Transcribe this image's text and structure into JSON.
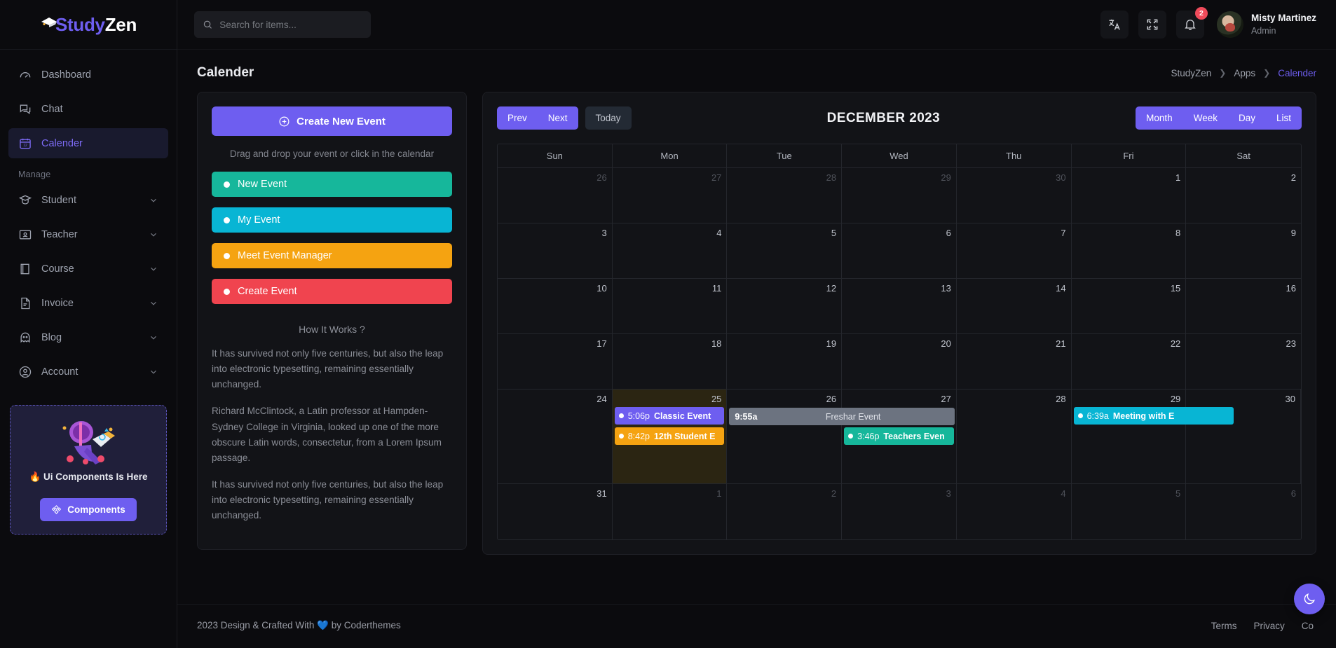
{
  "brand": {
    "part1": "Study",
    "part2": "Zen"
  },
  "sidebar": {
    "items": [
      {
        "label": "Dashboard",
        "icon": "gauge-icon",
        "active": false,
        "chevron": false
      },
      {
        "label": "Chat",
        "icon": "chat-icon",
        "active": false,
        "chevron": false
      },
      {
        "label": "Calender",
        "icon": "calendar-icon",
        "active": true,
        "chevron": false
      }
    ],
    "section_title": "Manage",
    "manage_items": [
      {
        "label": "Student",
        "icon": "graduation-cap-icon",
        "chevron": true
      },
      {
        "label": "Teacher",
        "icon": "teacher-board-icon",
        "chevron": true
      },
      {
        "label": "Course",
        "icon": "book-icon",
        "chevron": true
      },
      {
        "label": "Invoice",
        "icon": "file-text-icon",
        "chevron": true
      },
      {
        "label": "Blog",
        "icon": "ghost-icon",
        "chevron": true
      },
      {
        "label": "Account",
        "icon": "user-circle-icon",
        "chevron": true
      }
    ],
    "promo": {
      "title": "🔥 Ui Components Is Here",
      "button_label": "Components",
      "button_icon": "components-icon"
    }
  },
  "topbar": {
    "search": {
      "placeholder": "Search for items...",
      "value": "",
      "icon": "search-icon"
    },
    "language_icon": "translate-icon",
    "fullscreen_icon": "fullscreen-icon",
    "notification_icon": "bell-icon",
    "notification_count": "2",
    "user": {
      "name": "Misty Martinez",
      "role": "Admin"
    }
  },
  "page": {
    "title": "Calender",
    "breadcrumb": [
      {
        "label": "StudyZen",
        "current": false
      },
      {
        "label": "Apps",
        "current": false
      },
      {
        "label": "Calender",
        "current": true
      }
    ]
  },
  "left_panel": {
    "create_button": {
      "label": "Create New Event",
      "icon": "plus-circle-icon"
    },
    "hint": "Drag and drop your event or click in the calendar",
    "draggable_events": [
      {
        "label": "New Event",
        "color": "#16b79b"
      },
      {
        "label": "My Event",
        "color": "#08b5d4"
      },
      {
        "label": "Meet Event Manager",
        "color": "#f5a311"
      },
      {
        "label": "Create Event",
        "color": "#f0444f"
      }
    ],
    "how_it_works_title": "How It Works ?",
    "paragraphs": [
      "It has survived not only five centuries, but also the leap into electronic typesetting, remaining essentially unchanged.",
      "Richard McClintock, a Latin professor at Hampden-Sydney College in Virginia, looked up one of the more obscure Latin words, consectetur, from a Lorem Ipsum passage.",
      "It has survived not only five centuries, but also the leap into electronic typesetting, remaining essentially unchanged."
    ]
  },
  "calendar": {
    "nav": {
      "prev": "Prev",
      "next": "Next",
      "today": "Today"
    },
    "title": "DECEMBER 2023",
    "views": [
      "Month",
      "Week",
      "Day",
      "List"
    ],
    "active_view": "Month",
    "weekdays": [
      "Sun",
      "Mon",
      "Tue",
      "Wed",
      "Thu",
      "Fri",
      "Sat"
    ],
    "weeks": [
      [
        {
          "day": "26",
          "other": true
        },
        {
          "day": "27",
          "other": true
        },
        {
          "day": "28",
          "other": true
        },
        {
          "day": "29",
          "other": true
        },
        {
          "day": "30",
          "other": true
        },
        {
          "day": "1",
          "other": false
        },
        {
          "day": "2",
          "other": false
        }
      ],
      [
        {
          "day": "3"
        },
        {
          "day": "4"
        },
        {
          "day": "5"
        },
        {
          "day": "6"
        },
        {
          "day": "7"
        },
        {
          "day": "8"
        },
        {
          "day": "9"
        }
      ],
      [
        {
          "day": "10"
        },
        {
          "day": "11"
        },
        {
          "day": "12"
        },
        {
          "day": "13"
        },
        {
          "day": "14"
        },
        {
          "day": "15"
        },
        {
          "day": "16"
        }
      ],
      [
        {
          "day": "17"
        },
        {
          "day": "18"
        },
        {
          "day": "19"
        },
        {
          "day": "20"
        },
        {
          "day": "21"
        },
        {
          "day": "22"
        },
        {
          "day": "23"
        }
      ],
      [
        {
          "day": "24"
        },
        {
          "day": "25",
          "highlight": true
        },
        {
          "day": "26"
        },
        {
          "day": "27"
        },
        {
          "day": "28"
        },
        {
          "day": "29"
        },
        {
          "day": "30"
        }
      ],
      [
        {
          "day": "31"
        },
        {
          "day": "1",
          "other": true
        },
        {
          "day": "2",
          "other": true
        },
        {
          "day": "3",
          "other": true
        },
        {
          "day": "4",
          "other": true
        },
        {
          "day": "5",
          "other": true
        },
        {
          "day": "6",
          "other": true
        }
      ]
    ],
    "events": [
      {
        "time": "5:06p",
        "name": "Classic Event",
        "color": "#6e5ef0",
        "col": 1,
        "row": 0
      },
      {
        "time": "8:42p",
        "name": "12th Student E",
        "color": "#f5a311",
        "col": 1,
        "row": 1
      },
      {
        "time": "3:46p",
        "name": "Teachers Even",
        "color": "#16b79b",
        "col": 3,
        "row": 1
      }
    ],
    "span_event": {
      "time": "9:55a",
      "name": "Freshar Event",
      "color": "#6c7380"
    },
    "cyan_event": {
      "time": "6:39a",
      "name": "Meeting with E",
      "color": "#08b5d4"
    }
  },
  "footer": {
    "copyright_pre": "2023 Design & Crafted With",
    "heart": "💙",
    "copyright_post": "by Coderthemes",
    "links": [
      "Terms",
      "Privacy",
      "Co"
    ],
    "theme_toggle_icon": "moon-icon"
  }
}
